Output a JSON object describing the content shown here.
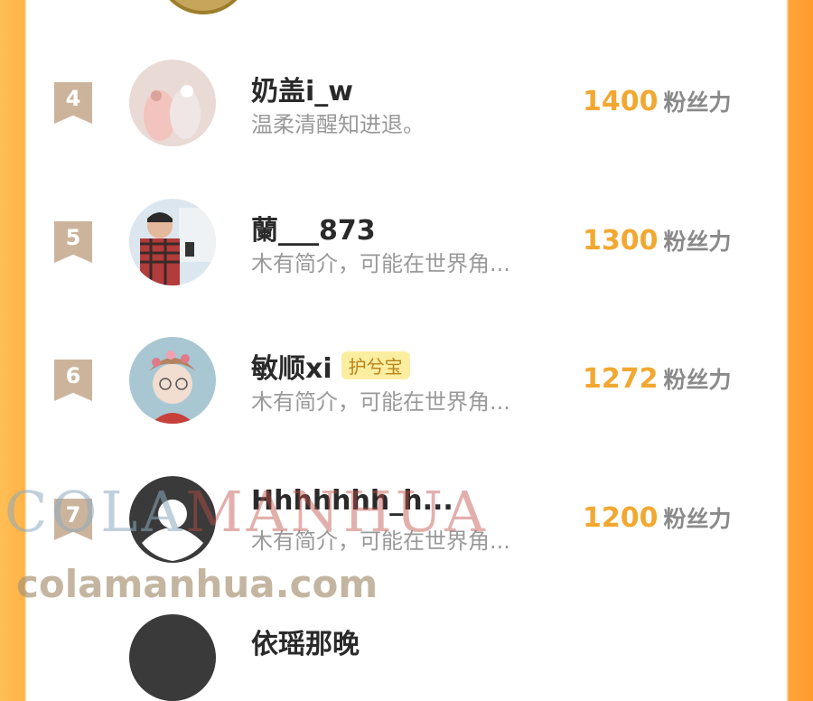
{
  "ranking": {
    "rows": [
      {
        "rank": "4",
        "name": "奶盖i_w",
        "badge": "",
        "bio": "温柔清醒知进退。",
        "score": "1400",
        "unit": "粉丝力",
        "avatar": "avatar-baby-feet"
      },
      {
        "rank": "5",
        "name": "蘭___873",
        "badge": "",
        "bio": "木有简介，可能在世界角...",
        "score": "1300",
        "unit": "粉丝力",
        "avatar": "avatar-boy-phone"
      },
      {
        "rank": "6",
        "name": "敏顺xi",
        "badge": "护兮宝",
        "bio": "木有简介，可能在世界角...",
        "score": "1272",
        "unit": "粉丝力",
        "avatar": "avatar-flower-crown"
      },
      {
        "rank": "7",
        "name": "Hhhhhhh_h...",
        "badge": "",
        "bio": "木有简介，可能在世界角...",
        "score": "1200",
        "unit": "粉丝力",
        "avatar": "avatar-default"
      }
    ],
    "next_partial_name": "依瑶那晚"
  },
  "watermark": {
    "line1_part1": "COLA",
    "line1_part2": "MANHUA",
    "line2": "colamanhua.com"
  },
  "colors": {
    "score": "#f2a830",
    "rank_flag": "#ccb49c",
    "badge_bg": "#fbeea0"
  }
}
